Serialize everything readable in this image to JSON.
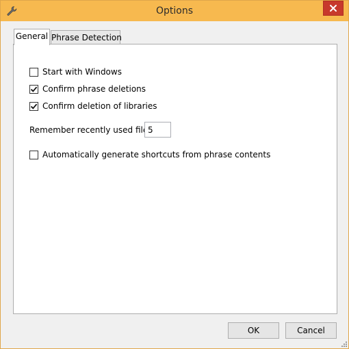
{
  "window": {
    "title": "Options",
    "titlebar_color": "#f7b94f",
    "app_icon": "wrench-icon",
    "close_icon": "close-icon"
  },
  "tabs": [
    {
      "label": "General",
      "selected": true
    },
    {
      "label": "Phrase Detection",
      "selected": false
    }
  ],
  "general": {
    "options": [
      {
        "label": "Start with Windows",
        "checked": false
      },
      {
        "label": "Confirm phrase deletions",
        "checked": true
      },
      {
        "label": "Confirm deletion of libraries",
        "checked": true
      }
    ],
    "recent_files": {
      "label": "Remember recently used files:",
      "value": "5"
    },
    "auto_shortcuts": {
      "label": "Automatically generate shortcuts from phrase contents",
      "checked": false
    }
  },
  "buttons": {
    "ok": "OK",
    "cancel": "Cancel"
  }
}
